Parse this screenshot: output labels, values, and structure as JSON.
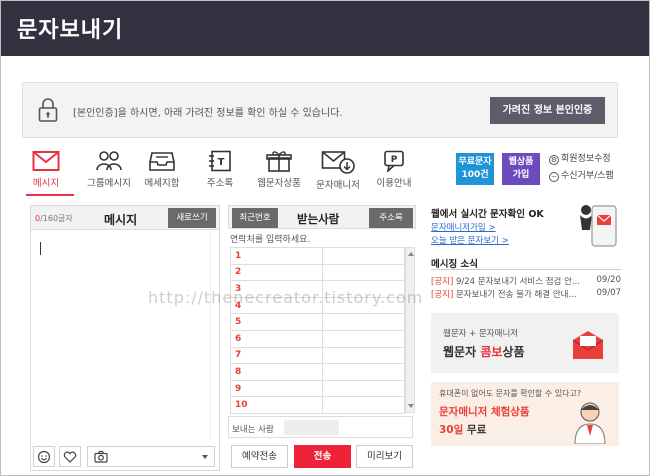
{
  "window": {
    "title": "문자보내기"
  },
  "auth": {
    "notice": "[본인인증]을 하시면, 아래 가려진 정보를 확인 하실 수 있습니다.",
    "button": "가려진 정보 본인인증"
  },
  "tabs": [
    {
      "label": "메시지",
      "icon": "envelope-icon",
      "active": true
    },
    {
      "label": "그룹메시지",
      "icon": "group-icon"
    },
    {
      "label": "메세지함",
      "icon": "inbox-icon"
    },
    {
      "label": "주소록",
      "icon": "address-book-icon"
    },
    {
      "label": "웹문자상품",
      "icon": "gift-icon"
    },
    {
      "label": "문자매니저",
      "icon": "mail-download-icon"
    },
    {
      "label": "이용안내",
      "icon": "help-chat-icon"
    }
  ],
  "badges": {
    "free": {
      "line1": "무료문자",
      "line2": "100건"
    },
    "web": {
      "line1": "웹상품",
      "line2": "가입"
    }
  },
  "account_links": {
    "edit": "회원정보수정",
    "block": "수신거부/스팸"
  },
  "composer": {
    "count_current": "0",
    "count_max": "/160글자",
    "title": "메시지",
    "new_button": "새로쓰기",
    "text": ""
  },
  "recipients": {
    "recent_button": "최근번호",
    "title": "받는사람",
    "addressbook_button": "주소록",
    "hint": "연락처를 입력하세요.",
    "rows": [
      "1",
      "2",
      "3",
      "4",
      "5",
      "6",
      "7",
      "8",
      "9",
      "10"
    ]
  },
  "sender": {
    "label": "보내는 사람"
  },
  "actions": {
    "reserve": "예약전송",
    "send": "전송",
    "preview": "미리보기"
  },
  "web_check": {
    "title": "웹에서 실시간 문자확인 OK",
    "link1": "문자매니저가입 >",
    "link2": "오늘 받은 문자보기 >"
  },
  "news": {
    "title": "메시징 소식",
    "items": [
      {
        "tag": "[공지]",
        "text": "9/24 문자보내기 서비스 점검 안...",
        "date": "09/20"
      },
      {
        "tag": "[공지]",
        "text": "문자보내기 전송 불가 해결 안내...",
        "date": "09/07"
      }
    ]
  },
  "ad1": {
    "line1": "웹문자 + 문자매니저",
    "pre": "웹문자 ",
    "highlight": "콤보",
    "post": "상품"
  },
  "ad2": {
    "line1": "휴대폰이 없어도 문자를 확인할 수 있다고?",
    "line2": "문자매니저 체험상품",
    "days": "30일",
    "free": " 무료"
  },
  "watermark": "http://thenecreator.tistory.com"
}
